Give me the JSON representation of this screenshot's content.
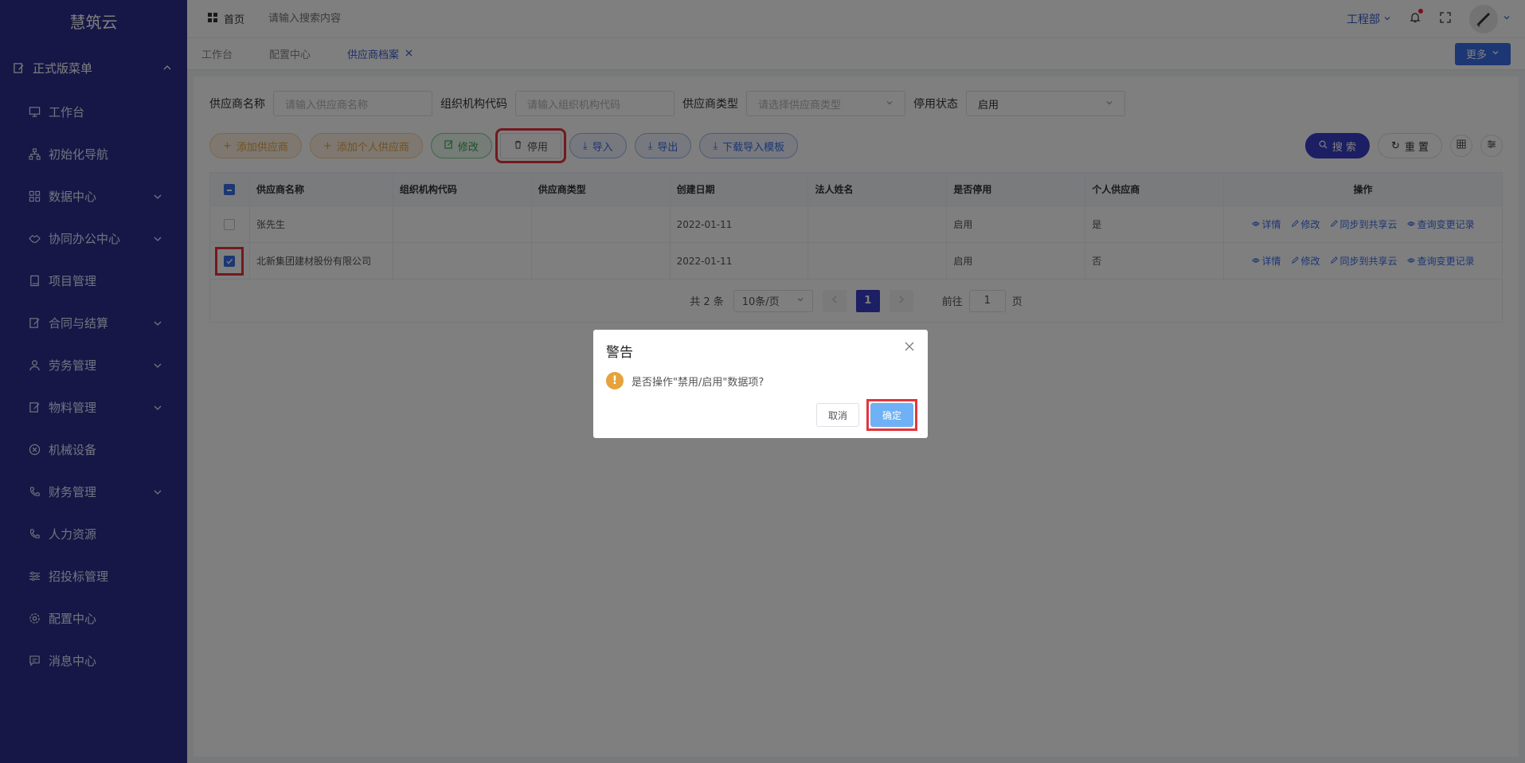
{
  "sidebar": {
    "logo": "慧筑云",
    "group": "正式版菜单",
    "items": [
      {
        "label": "工作台",
        "icon": "monitor-icon",
        "has_chevron": false
      },
      {
        "label": "初始化导航",
        "icon": "sitemap-icon",
        "has_chevron": false
      },
      {
        "label": "数据中心",
        "icon": "grid-icon",
        "has_chevron": true
      },
      {
        "label": "协同办公中心",
        "icon": "handshake-icon",
        "has_chevron": true
      },
      {
        "label": "项目管理",
        "icon": "book-icon",
        "has_chevron": false
      },
      {
        "label": "合同与结算",
        "icon": "edit-doc-icon",
        "has_chevron": true
      },
      {
        "label": "劳务管理",
        "icon": "worker-icon",
        "has_chevron": true
      },
      {
        "label": "物料管理",
        "icon": "edit-doc-icon",
        "has_chevron": true
      },
      {
        "label": "机械设备",
        "icon": "circle-x-icon",
        "has_chevron": false
      },
      {
        "label": "财务管理",
        "icon": "phone-icon",
        "has_chevron": true
      },
      {
        "label": "人力资源",
        "icon": "phone-icon",
        "has_chevron": false
      },
      {
        "label": "招投标管理",
        "icon": "sliders-icon",
        "has_chevron": false
      },
      {
        "label": "配置中心",
        "icon": "gear-icon",
        "has_chevron": false
      },
      {
        "label": "消息中心",
        "icon": "message-icon",
        "has_chevron": false
      }
    ]
  },
  "topbar": {
    "home": "首页",
    "search_placeholder": "请输入搜索内容",
    "department": "工程部"
  },
  "tabs": {
    "items": [
      "工作台",
      "配置中心",
      "供应商档案"
    ],
    "more": "更多"
  },
  "filters": {
    "supplier_name_label": "供应商名称",
    "supplier_name_placeholder": "请输入供应商名称",
    "org_code_label": "组织机构代码",
    "org_code_placeholder": "请输入组织机构代码",
    "supplier_type_label": "供应商类型",
    "supplier_type_placeholder": "请选择供应商类型",
    "status_label": "停用状态",
    "status_value": "启用"
  },
  "actions": {
    "add_supplier": "添加供应商",
    "add_personal": "添加个人供应商",
    "edit": "修改",
    "disable": "停用",
    "import": "导入",
    "export": "导出",
    "download_template": "下载导入模板",
    "search": "搜 索",
    "reset": "重 置"
  },
  "table": {
    "headers": [
      "供应商名称",
      "组织机构代码",
      "供应商类型",
      "创建日期",
      "法人姓名",
      "是否停用",
      "个人供应商",
      "操作"
    ],
    "rows": [
      {
        "name": "张先生",
        "org_code": "",
        "type": "",
        "date": "2022-01-11",
        "legal": "",
        "status": "启用",
        "personal": "是",
        "checked": false
      },
      {
        "name": "北新集团建材股份有限公司",
        "org_code": "",
        "type": "",
        "date": "2022-01-11",
        "legal": "",
        "status": "启用",
        "personal": "否",
        "checked": true
      }
    ],
    "ops": [
      "详情",
      "修改",
      "同步到共享云",
      "查询变更记录"
    ]
  },
  "pager": {
    "total": "共 2 条",
    "page_size": "10条/页",
    "current": "1",
    "goto_label": "前往",
    "goto_value": "1",
    "page_suffix": "页"
  },
  "dialog": {
    "title": "警告",
    "message": "是否操作\"禁用/启用\"数据项?",
    "cancel": "取消",
    "confirm": "确定"
  },
  "colors": {
    "sidebar_bg": "#2c2e8c",
    "primary": "#3a3ec9",
    "link": "#3a6fe8",
    "warning": "#e6a23c",
    "highlight": "#e5353b"
  }
}
